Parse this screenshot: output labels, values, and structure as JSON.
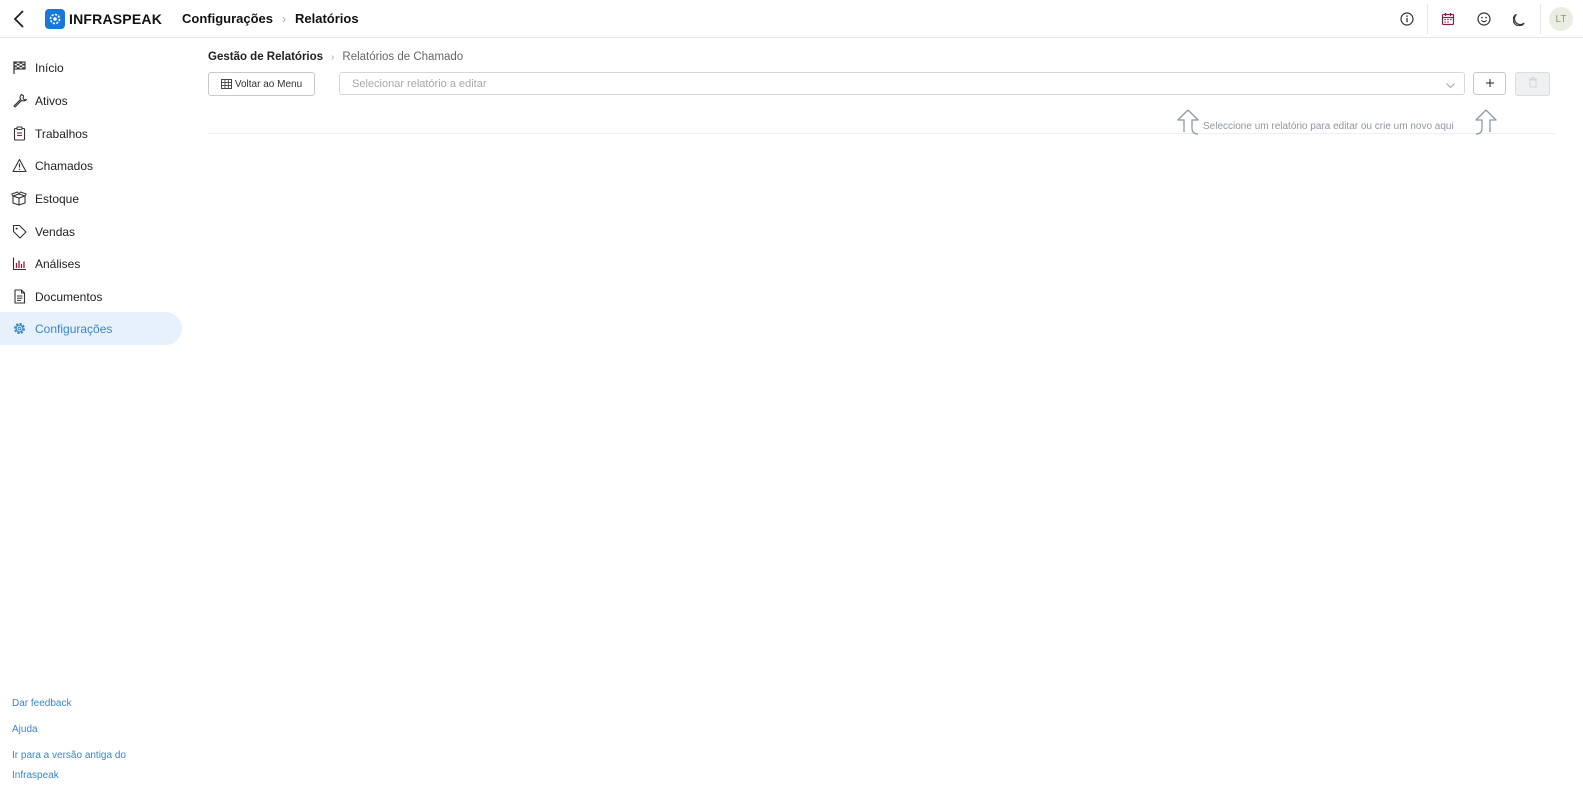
{
  "header": {
    "logo_text": "INFRASPEAK",
    "breadcrumb": [
      "Configurações",
      "Relatórios"
    ],
    "avatar_initials": "LT"
  },
  "sidebar": {
    "items": [
      {
        "label": "Início",
        "icon": "flag-checkered-icon"
      },
      {
        "label": "Ativos",
        "icon": "wrench-icon"
      },
      {
        "label": "Trabalhos",
        "icon": "clipboard-icon"
      },
      {
        "label": "Chamados",
        "icon": "warning-triangle-icon"
      },
      {
        "label": "Estoque",
        "icon": "box-icon"
      },
      {
        "label": "Vendas",
        "icon": "tag-icon"
      },
      {
        "label": "Análises",
        "icon": "bar-chart-icon"
      },
      {
        "label": "Documentos",
        "icon": "document-icon"
      },
      {
        "label": "Configurações",
        "icon": "gear-icon",
        "active": true
      }
    ],
    "footer": {
      "feedback": "Dar feedback",
      "help": "Ajuda",
      "old_version": "Ir para a versão antiga do Infraspeak"
    }
  },
  "main": {
    "breadcrumb": [
      "Gestão de Relatórios",
      "Relatórios de Chamado"
    ],
    "back_to_menu": "Voltar ao Menu",
    "select_placeholder": "Selecionar relatório a editar",
    "add_label": "+",
    "hint": "Seleccione um relatório para editar ou crie um novo aqui"
  },
  "colors": {
    "accent": "#3a85c8",
    "logo": "#1778d8",
    "active_bg": "#e6f1fb",
    "calendar_icon": "#8a1f4a"
  }
}
